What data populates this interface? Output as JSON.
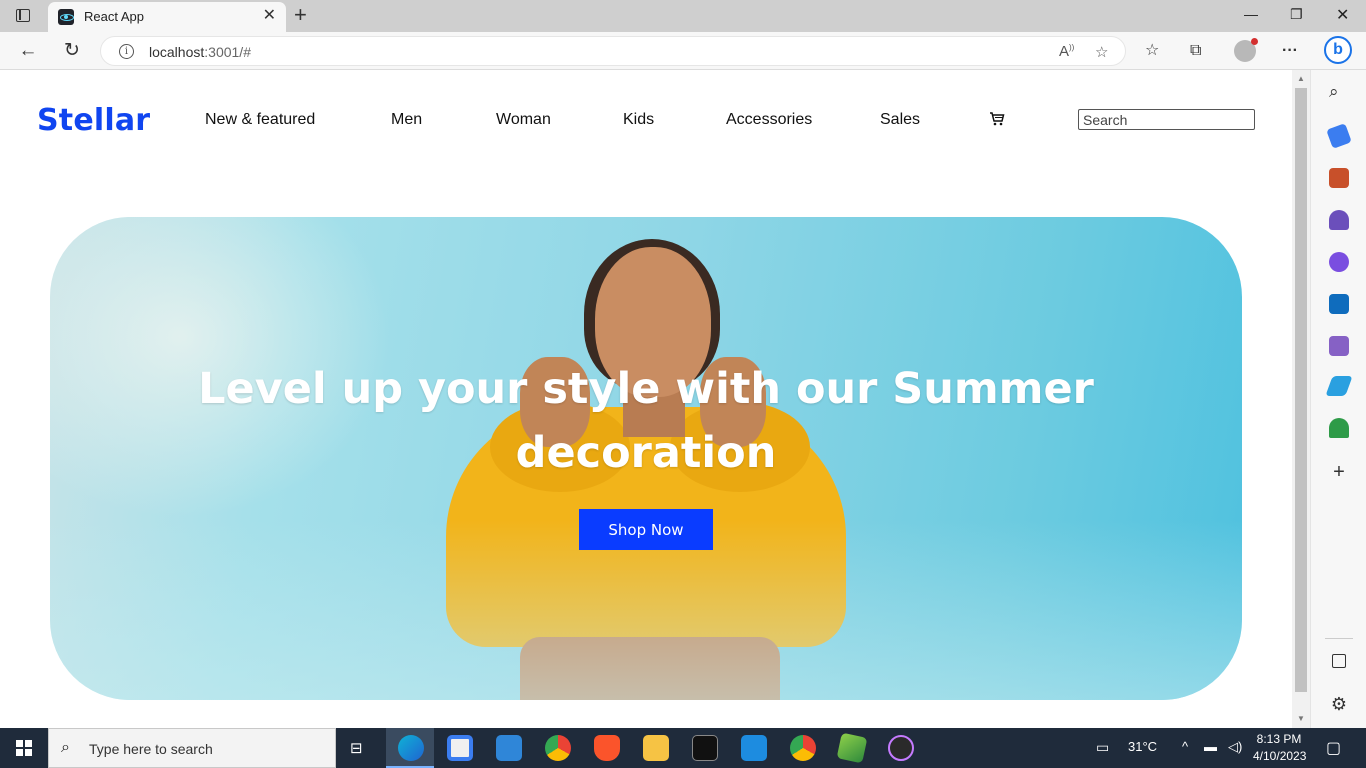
{
  "browser": {
    "tab_title": "React App",
    "url_host": "localhost",
    "url_rest": ":3001/#"
  },
  "site": {
    "brand": "Stellar",
    "nav": [
      {
        "label": "New & featured"
      },
      {
        "label": "Men"
      },
      {
        "label": "Woman"
      },
      {
        "label": "Kids"
      },
      {
        "label": "Accessories"
      },
      {
        "label": "Sales"
      }
    ],
    "search_placeholder": "Search",
    "brand_color": "#1045f0"
  },
  "hero": {
    "heading": "Level up your style with our Summer decoration",
    "button_label": "Shop Now",
    "button_color": "#0a3cff"
  },
  "taskbar": {
    "search_placeholder": "Type here to search",
    "weather": "31°C",
    "time": "8:13 PM",
    "date": "4/10/2023"
  }
}
